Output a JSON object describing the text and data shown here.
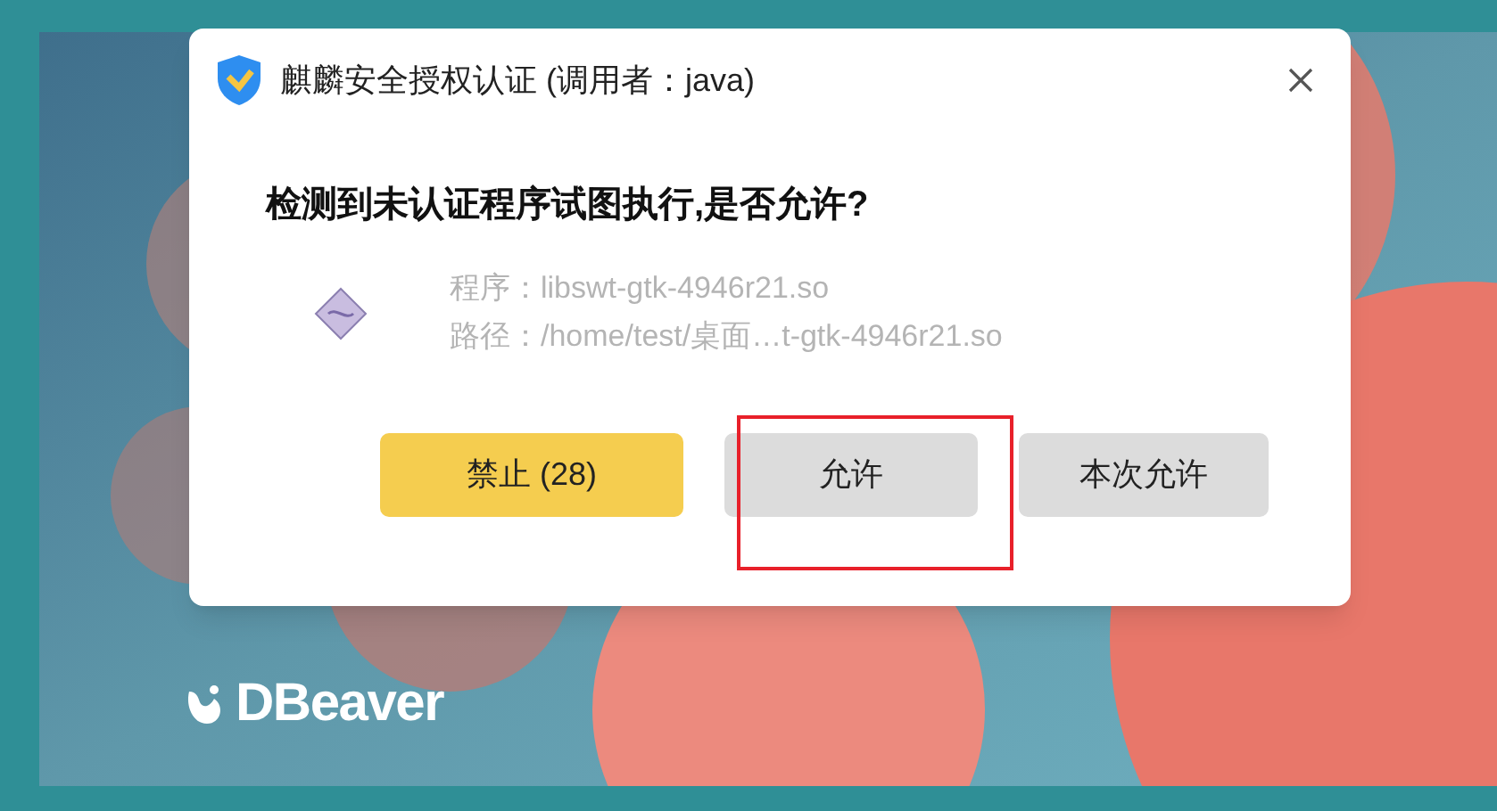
{
  "splash": {
    "brand": "DBeaver"
  },
  "dialog": {
    "title": "麒麟安全授权认证 (调用者：java)",
    "heading": "检测到未认证程序试图执行,是否允许?",
    "details": [
      {
        "label": "程序：",
        "value": "libswt-gtk-4946r21.so"
      },
      {
        "label": "路径：",
        "value": "/home/test/桌面…t-gtk-4946r21.so"
      }
    ],
    "buttons": [
      {
        "label": "禁止 (28)",
        "kind": "warning",
        "highlighted": false
      },
      {
        "label": "允许",
        "kind": "normal",
        "highlighted": true
      },
      {
        "label": "本次允许",
        "kind": "normal",
        "highlighted": false
      }
    ]
  }
}
